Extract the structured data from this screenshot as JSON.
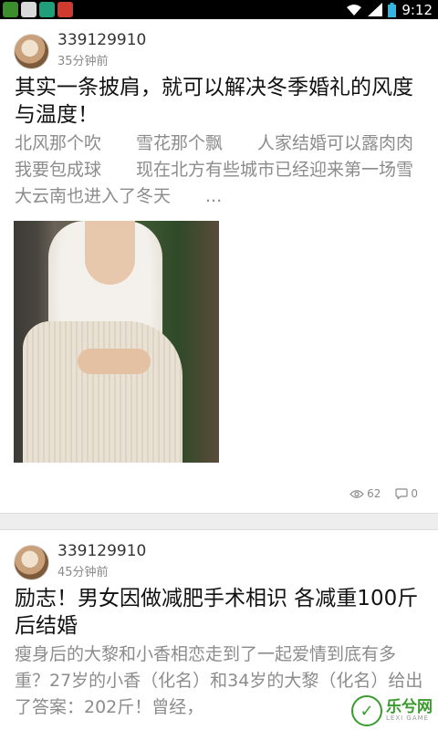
{
  "status_bar": {
    "time": "9:12",
    "left_icons": [
      "app-icon-1",
      "image-icon",
      "app-icon-2",
      "app-icon-3"
    ],
    "right_icons": [
      "wifi-icon",
      "signal-icon",
      "battery-icon"
    ]
  },
  "posts": [
    {
      "username": "339129910",
      "time": "35分钟前",
      "title": "其实一条披肩，就可以解决冬季婚礼的风度与温度！",
      "excerpt": "北风那个吹　　雪花那个飘　　人家结婚可以露肉肉　　我要包成球　　现在北方有些城市已经迎来第一场雪　　大云南也进入了冬天　　...",
      "views": "62",
      "comments": "0"
    },
    {
      "username": "339129910",
      "time": "45分钟前",
      "title": "励志！男女因做减肥手术相识 各减重100斤后结婚",
      "excerpt": "瘦身后的大黎和小香相恋走到了一起爱情到底有多重？27岁的小香（化名）和34岁的大黎（化名）给出了答案：202斤！曾经，"
    }
  ],
  "watermark": {
    "cn": "乐兮网",
    "en": "LEXI GAME"
  },
  "colors": {
    "status_bar": "#000000",
    "title": "#111111",
    "excerpt": "#8c8c8c",
    "watermark_green": "#3b9b2f"
  }
}
